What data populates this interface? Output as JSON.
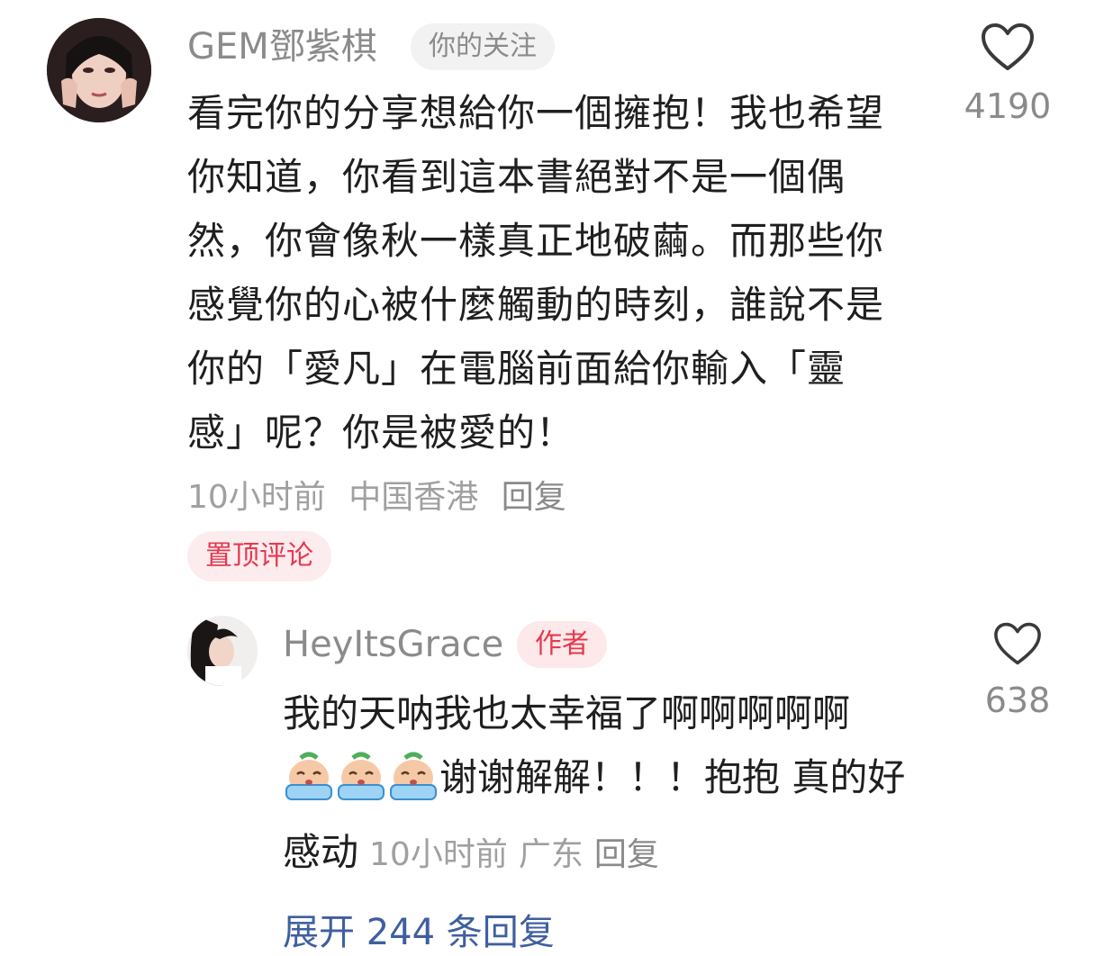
{
  "main_comment": {
    "username": "GEM鄧紫棋",
    "follow_badge": "你的关注",
    "text": "看完你的分享想給你一個擁抱！我也希望你知道，你看到這本書絕對不是一個偶然，你會像秋一樣真正地破繭。而那些你感覺你的心被什麼觸動的時刻，誰說不是你的「愛凡」在電腦前面給你輸入「靈感」呢？你是被愛的！",
    "time": "10小时前",
    "location": "中国香港",
    "reply_label": "回复",
    "pinned_label": "置顶评论",
    "likes": "4190"
  },
  "reply_comment": {
    "username": "HeyItsGrace",
    "author_badge": "作者",
    "text_before_emoji": "我的天呐我也太幸福了啊啊啊啊啊",
    "emoji_icons": [
      "crying-face-emoji",
      "crying-face-emoji",
      "crying-face-emoji"
    ],
    "text_after_emoji": "谢谢解解！！！抱抱 真的好感动",
    "time": "10小时前",
    "location": "广东",
    "reply_label": "回复",
    "likes": "638"
  },
  "expand_replies": "展开 244 条回复",
  "colors": {
    "pinned_text": "#e53950",
    "pinned_bg": "#fdecee",
    "author_badge_text": "#e33a4d",
    "meta_gray": "#a0a0a0",
    "expand_link": "#3f5f9f"
  }
}
